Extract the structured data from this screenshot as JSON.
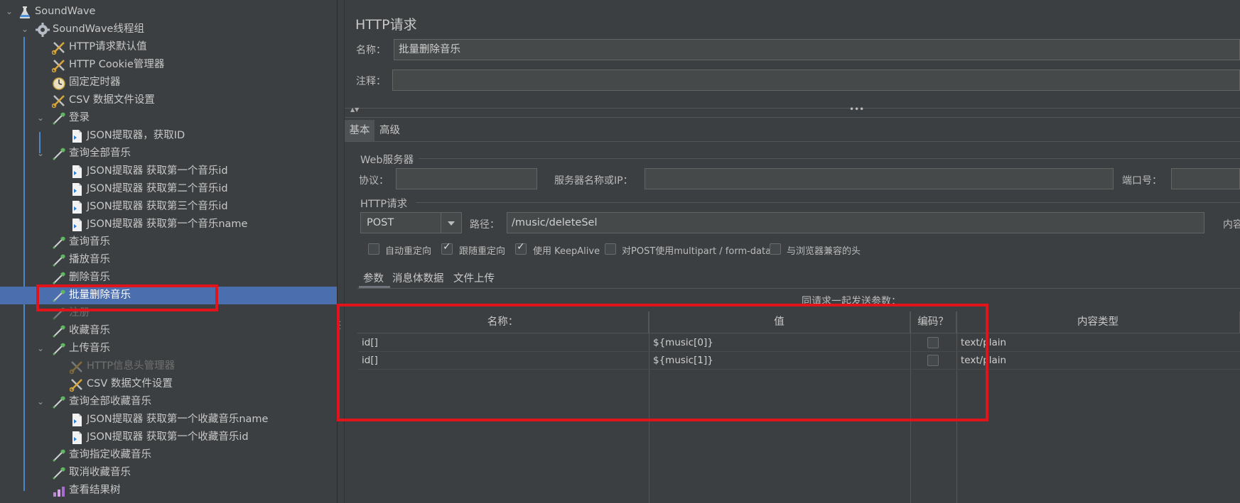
{
  "tree": {
    "items": [
      {
        "label": "SoundWave",
        "icon": "flask-icon",
        "level": 0,
        "expanded": true
      },
      {
        "label": "SoundWave线程组",
        "icon": "gear-icon",
        "level": 1,
        "expanded": true
      },
      {
        "label": "HTTP请求默认值",
        "icon": "wrench-scissors-icon",
        "level": 2
      },
      {
        "label": "HTTP Cookie管理器",
        "icon": "wrench-scissors-icon",
        "level": 2
      },
      {
        "label": "固定定时器",
        "icon": "timer-icon",
        "level": 2
      },
      {
        "label": "CSV 数据文件设置",
        "icon": "wrench-scissors-icon",
        "level": 2
      },
      {
        "label": "登录",
        "icon": "pipette-icon",
        "level": 2,
        "expanded": true
      },
      {
        "label": "JSON提取器，获取ID",
        "icon": "document-icon",
        "level": 3
      },
      {
        "label": "查询全部音乐",
        "icon": "pipette-icon",
        "level": 2,
        "expanded": true
      },
      {
        "label": "JSON提取器 获取第一个音乐id",
        "icon": "document-icon",
        "level": 3
      },
      {
        "label": "JSON提取器 获取第二个音乐id",
        "icon": "document-icon",
        "level": 3
      },
      {
        "label": "JSON提取器 获取第三个音乐id",
        "icon": "document-icon",
        "level": 3
      },
      {
        "label": "JSON提取器 获取第一个音乐name",
        "icon": "document-icon",
        "level": 3
      },
      {
        "label": "查询音乐",
        "icon": "pipette-icon",
        "level": 2
      },
      {
        "label": "播放音乐",
        "icon": "pipette-icon",
        "level": 2
      },
      {
        "label": "删除音乐",
        "icon": "pipette-icon",
        "level": 2
      },
      {
        "label": "批量删除音乐",
        "icon": "pipette-icon",
        "level": 2,
        "selected": true
      },
      {
        "label": "注册",
        "icon": "pipette-icon",
        "level": 2,
        "disabled": true
      },
      {
        "label": "收藏音乐",
        "icon": "pipette-icon",
        "level": 2
      },
      {
        "label": "上传音乐",
        "icon": "pipette-icon",
        "level": 2,
        "expanded": true
      },
      {
        "label": "HTTP信息头管理器",
        "icon": "wrench-scissors-icon",
        "level": 3,
        "disabled": true
      },
      {
        "label": "CSV 数据文件设置",
        "icon": "wrench-scissors-icon",
        "level": 3
      },
      {
        "label": "查询全部收藏音乐",
        "icon": "pipette-icon",
        "level": 2,
        "expanded": true
      },
      {
        "label": "JSON提取器 获取第一个收藏音乐name",
        "icon": "document-icon",
        "level": 3
      },
      {
        "label": "JSON提取器 获取第一个收藏音乐id",
        "icon": "document-icon",
        "level": 3
      },
      {
        "label": "查询指定收藏音乐",
        "icon": "pipette-icon",
        "level": 2
      },
      {
        "label": "取消收藏音乐",
        "icon": "pipette-icon",
        "level": 2
      },
      {
        "label": "查看结果树",
        "icon": "chart-icon",
        "level": 2
      }
    ]
  },
  "panel": {
    "title": "HTTP请求",
    "name_label": "名称：",
    "name_value": "批量删除音乐",
    "comment_label": "注释：",
    "comment_value": "",
    "tabs": [
      "基本",
      "高级"
    ],
    "web_server": {
      "section": "Web服务器",
      "protocol_label": "协议：",
      "server_label": "服务器名称或IP：",
      "port_label": "端口号："
    },
    "http_request": {
      "section": "HTTP请求",
      "method": "POST",
      "path_label": "路径：",
      "path_value": "/music/deleteSel",
      "content_label_partial": "内容"
    },
    "options": [
      {
        "label": "自动重定向",
        "checked": false
      },
      {
        "label": "跟随重定向",
        "checked": true
      },
      {
        "label": "使用 KeepAlive",
        "checked": true
      },
      {
        "label": "对POST使用multipart / form-data",
        "checked": false
      },
      {
        "label": "与浏览器兼容的头",
        "checked": false
      }
    ],
    "sub_tabs": [
      "参数",
      "消息体数据",
      "文件上传"
    ],
    "params_caption": "同请求一起发送参数：",
    "table": {
      "headers": [
        "名称：",
        "值",
        "编码？",
        "内容类型"
      ],
      "rows": [
        {
          "name": "id[]",
          "value": "${music[0]}",
          "encode": false,
          "content_type": "text/plain"
        },
        {
          "name": "id[]",
          "value": "${music[1]}",
          "encode": false,
          "content_type": "text/plain"
        }
      ]
    }
  },
  "colors": {
    "background": "#3c3f41",
    "selection": "#4b6eaf",
    "highlight_box": "#e0141a"
  }
}
